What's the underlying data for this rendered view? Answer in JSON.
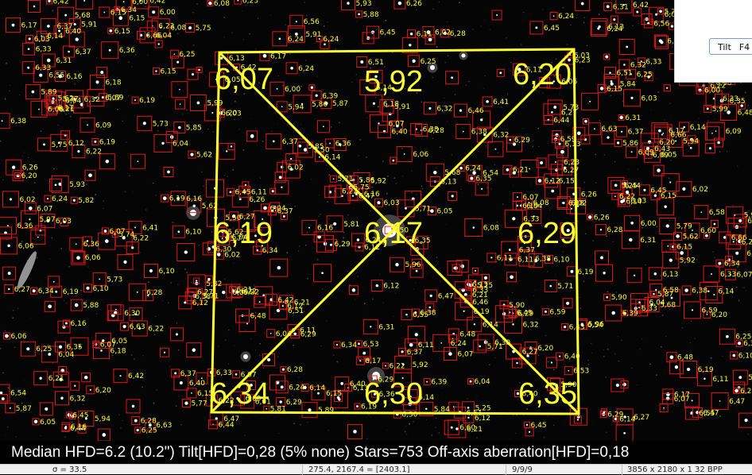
{
  "colors": {
    "box": "#e01818",
    "label": "#ffff3a",
    "overlay": "#ffff30",
    "background": "#050505"
  },
  "tilt_grid": {
    "top_left": "6,07",
    "top": "5,92",
    "top_right": "6,20",
    "left": "6,19",
    "center": "6,17",
    "right": "6,29",
    "bottom_left": "6,34",
    "bottom": "6,30",
    "bottom_right": "6,35"
  },
  "summary": "Median HFD=6.2 (10.2\")  Tilt[HFD]=0,28 (5% none)  Stars=753  Off-axis aberration[HFD]=0,18",
  "status_bar": {
    "sigma": "σ = 33.5",
    "coords": "275.4, 2167.4 = [2403.1]",
    "value": "9/9/9",
    "image_info": "3856 x 2180 x 1   32 BPP"
  },
  "tilt_panel": {
    "button_label": "Tilt",
    "button_shortcut": "F4"
  },
  "star_labels": [
    "5,50",
    "5,90",
    "5,71",
    "6,07",
    "5,92",
    "6,09",
    "6,22",
    "6,11",
    "6,03",
    "6,10",
    "6,36",
    "6,20",
    "5,77",
    "6,07",
    "5,81",
    "6,54",
    "5,89",
    "6,25",
    "6,44",
    "6,45",
    "6,33",
    "6,00",
    "5,62",
    "6,14",
    "5,68",
    "6,19",
    "6,18",
    "6,34",
    "5,71",
    "6,06",
    "5,73",
    "6,05",
    "6,40",
    "6,15",
    "6,22",
    "6,13",
    "6,38",
    "6,28",
    "6,02",
    "5,86",
    "6,24",
    "6,20",
    "6,43",
    "6,25",
    "6,42",
    "6,08",
    "5,62",
    "6,17",
    "6,31",
    "6,51",
    "6,26",
    "6,12",
    "5,94",
    "6,26",
    "5,25",
    "6,37",
    "6,48",
    "6,15",
    "5,87",
    "6,24",
    "5,91",
    "6,66",
    "6,32",
    "6,03",
    "6,29",
    "5,97",
    "6,33",
    "6,07",
    "6,16",
    "6,59",
    "6,04",
    "5,82",
    "6,63",
    "6,21",
    "6,11",
    "6,04",
    "6,47",
    "6,39",
    "5,75",
    "6,14",
    "6,55",
    "6,28",
    "6,05",
    "6,14",
    "6,37",
    "6,22",
    "6,55",
    "6,10",
    "6,34",
    "6,07",
    "6,42",
    "6,04",
    "5,99",
    "6,38",
    "6,27",
    "6,51",
    "6,21",
    "6,09",
    "6,30",
    "6,13",
    "6,47",
    "5,93",
    "6,18",
    "6,37",
    "5,74",
    "6,27",
    "6,15",
    "6,35",
    "6,45",
    "6,19",
    "5,88",
    "6,33",
    "6,24",
    "6,16",
    "6,12",
    "6,60",
    "6,29",
    "6,36",
    "5,84",
    "6,35",
    "6,02",
    "6,38",
    "6,23",
    "6,01",
    "6,41",
    "6,14",
    "6,32",
    "6,19",
    "6,06",
    "6,53",
    "6,17",
    "6,24",
    "5,96",
    "6,40",
    "6,12",
    "6,46",
    "6,27",
    "6,15",
    "6,58",
    "6,00",
    "6,38",
    "6,22",
    "6,16",
    "6,04",
    "6,44",
    "6,31",
    "5,79",
    "6,26",
    "6,13",
    "6,33",
    "6,08",
    "6,50",
    "6,21",
    "6,11",
    "6,42",
    "6,03",
    "6,36",
    "6,18",
    "6,27",
    "6,06",
    "6,48",
    "6,20",
    "6,09",
    "6,39",
    "6,30",
    "6,14",
    "5,85",
    "6,23",
    "6,45",
    "6,17",
    "6,02",
    "6,32",
    "6,56",
    "6,19",
    "6,29",
    "6,11",
    "6,40",
    "6,25"
  ]
}
